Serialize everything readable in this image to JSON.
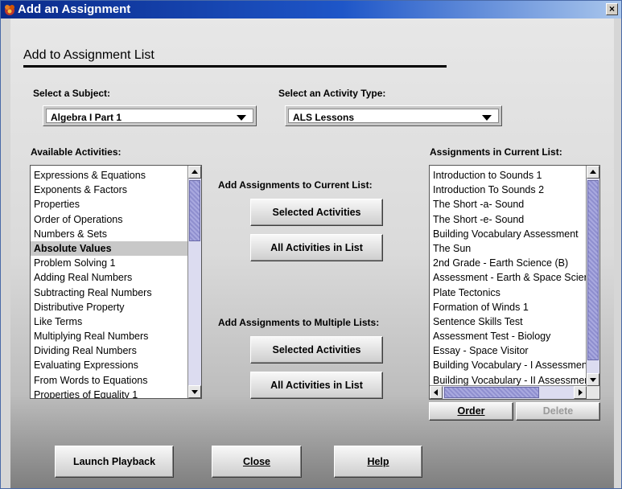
{
  "window": {
    "title": "Add an Assignment",
    "close_glyph": "×"
  },
  "heading": "Add to Assignment List",
  "subject": {
    "label": "Select a Subject:",
    "value": "Algebra I Part 1"
  },
  "activity_type": {
    "label": "Select an Activity Type:",
    "value": "ALS Lessons"
  },
  "available": {
    "label": "Available Activities:",
    "selected_index": 5,
    "items": [
      "Expressions & Equations",
      "Exponents & Factors",
      "Properties",
      "Order of Operations",
      "Numbers & Sets",
      "Absolute Values",
      "Problem Solving 1",
      "Adding Real Numbers",
      "Subtracting Real Numbers",
      "Distributive Property",
      "Like Terms",
      "Multiplying Real Numbers",
      "Dividing Real Numbers",
      "Evaluating Expressions",
      "From Words to Equations",
      "Properties of Equality 1"
    ]
  },
  "add_current": {
    "label": "Add Assignments to Current List:",
    "selected_btn": "Selected Activities",
    "all_btn": "All Activities in List"
  },
  "add_multiple": {
    "label": "Add Assignments to Multiple Lists:",
    "selected_btn": "Selected Activities",
    "all_btn": "All Activities in List"
  },
  "current": {
    "label": "Assignments in Current List:",
    "items": [
      "Introduction to Sounds 1",
      "Introduction To Sounds 2",
      "The Short -a- Sound",
      "The Short -e- Sound",
      "Building Vocabulary Assessment",
      "The Sun",
      "2nd Grade - Earth Science (B)",
      "Assessment - Earth & Space Science",
      "Plate Tectonics",
      "Formation of Winds 1",
      "Sentence Skills Test",
      "Assessment Test - Biology",
      "Essay - Space Visitor",
      "Building Vocabulary - I Assessment",
      "Building Vocabulary - II Assessment"
    ]
  },
  "order_btn": "Order",
  "delete_btn": "Delete",
  "launch_btn": "Launch Playback",
  "close_btn": "Close",
  "help_btn": "Help",
  "colors": {
    "title_start": "#0a2a8a",
    "title_end": "#a9c6ec",
    "scroll_thumb": "#a9a9df"
  }
}
